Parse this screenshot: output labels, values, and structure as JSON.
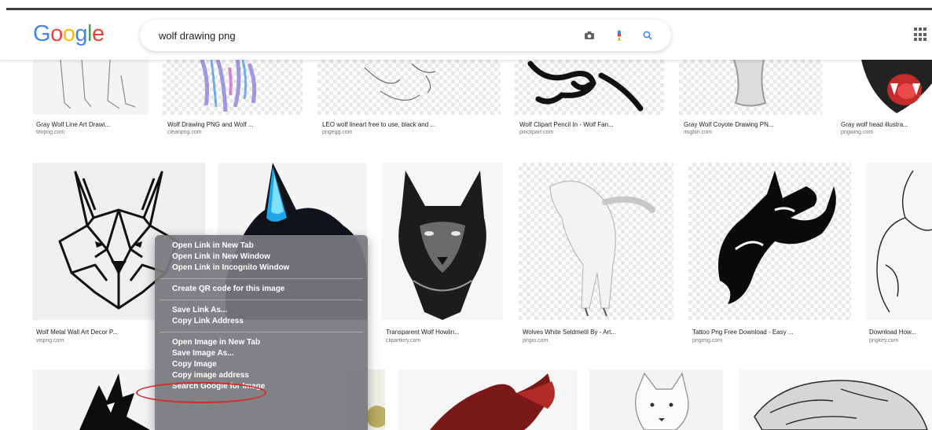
{
  "header": {
    "logo_text": [
      "G",
      "o",
      "o",
      "g",
      "l",
      "e"
    ],
    "logo_colors": [
      "#4285f4",
      "#ea4335",
      "#fbbc05",
      "#4285f4",
      "#34a853",
      "#ea4335"
    ],
    "search_value": "wolf drawing png",
    "icons": [
      "camera-icon",
      "microphone-icon",
      "search-icon",
      "apps-grid-icon"
    ],
    "accent_blue": "#4285f4"
  },
  "row1": [
    {
      "caption": "Gray Wolf Line Art Drawi...",
      "source": "favpng.com"
    },
    {
      "caption": "Wolf Drawing PNG and Wolf ...",
      "source": "cleanpng.com"
    },
    {
      "caption": "LEO wolf lineart free to use, black and ...",
      "source": "pngegg.com"
    },
    {
      "caption": "Wolf Clipart Pencil In - Wolf Fan...",
      "source": "pinclipart.com"
    },
    {
      "caption": "Gray Wolf Coyote Drawing PN...",
      "source": "imgbin.com"
    },
    {
      "caption": "Gray wolf head illustra...",
      "source": "pngwing.com"
    }
  ],
  "row2": [
    {
      "caption": "Wolf Metal Wall Art Decor P...",
      "source": "vispng.com"
    },
    {
      "caption": "",
      "source": ""
    },
    {
      "caption": "Transparent Wolf Howlin...",
      "source": "clipartkey.com"
    },
    {
      "caption": "Wolves White Seldmetil By - Art...",
      "source": "pngio.com"
    },
    {
      "caption": "Tattoo Png Free Download - Easy ...",
      "source": "pngimg.com"
    },
    {
      "caption": "Download How...",
      "source": "pngkey.com"
    }
  ],
  "context_menu": {
    "groups": [
      [
        "Open Link in New Tab",
        "Open Link in New Window",
        "Open Link in Incognito Window"
      ],
      [
        "Create QR code for this image"
      ],
      [
        "Save Link As...",
        "Copy Link Address"
      ],
      [
        "Open Image in New Tab",
        "Save Image As...",
        "Copy Image",
        "Copy image address",
        "Search Google for Image"
      ]
    ],
    "highlighted_item": "Copy Image",
    "highlight_color": "#d4262b"
  }
}
